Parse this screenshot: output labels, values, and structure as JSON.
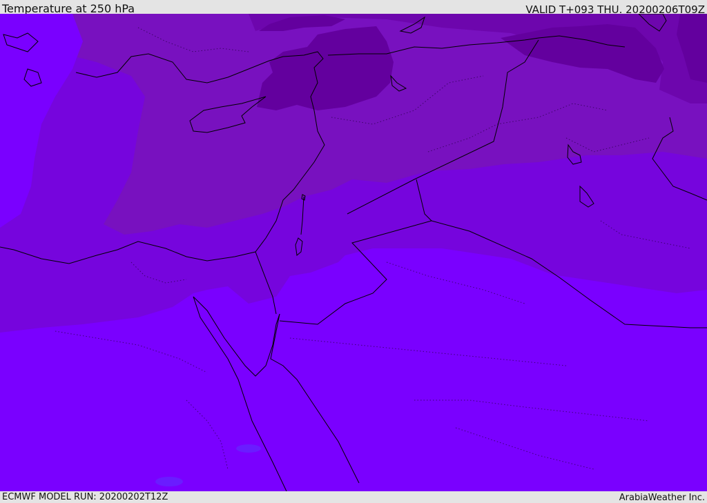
{
  "header": {
    "title": "Temperature at 250 hPa",
    "valid_time": "VALID T+093 THU. 20200206T09Z"
  },
  "footer": {
    "model_run": "ECMWF MODEL RUN: 20200202T12Z",
    "credit": "ArabiaWeather Inc."
  },
  "map": {
    "colors": {
      "darkest_violet": "#63009e",
      "dark_violet": "#6d06ad",
      "mid_violet": "#7811bf",
      "violet": "#7605dd",
      "bright_violet": "#7a00ff",
      "cold_core_blue": "#4b3cff",
      "coastline": "#000000"
    }
  }
}
